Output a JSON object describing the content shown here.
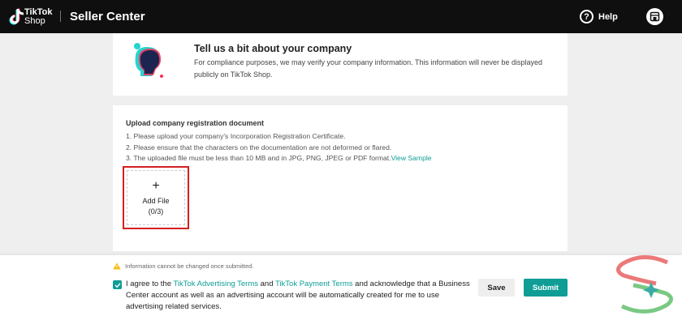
{
  "header": {
    "logo_text_line1": "TikTok",
    "logo_text_line2": "Shop",
    "app_title": "Seller Center",
    "help_label": "Help",
    "icons": {
      "logo": "tiktok-note-icon",
      "help": "question-circle-icon",
      "store": "store-icon"
    }
  },
  "intro": {
    "title": "Tell us a bit about your company",
    "description": "For compliance purposes, we may verify your company information. This information will never be displayed publicly on TikTok Shop."
  },
  "upload": {
    "title": "Upload company registration document",
    "rules": [
      "1. Please upload your company's Incorporation Registration Certificate.",
      "2. Please ensure that the characters on the documentation are not deformed or flared.",
      "3. The uploaded file must be less than 10 MB and in JPG, PNG, JPEG or PDF format."
    ],
    "view_sample_link": "View Sample",
    "add_file_label": "Add File",
    "add_file_count": "(0/3)"
  },
  "footer": {
    "warning": "Information cannot be changed once submitted.",
    "agree_prefix": "I agree to the ",
    "advertising_terms": "TikTok Advertising Terms",
    "and": " and ",
    "payment_terms": "TikTok Payment Terms",
    "agree_suffix": " and acknowledge that a Business Center account as well as an advertising account will be automatically created for me to use advertising related services.",
    "checkbox_checked": true,
    "save_label": "Save",
    "submit_label": "Submit"
  },
  "colors": {
    "accent": "#0f9d96",
    "header_bg": "#0f0f0f",
    "highlight_border": "#d41f1f"
  }
}
